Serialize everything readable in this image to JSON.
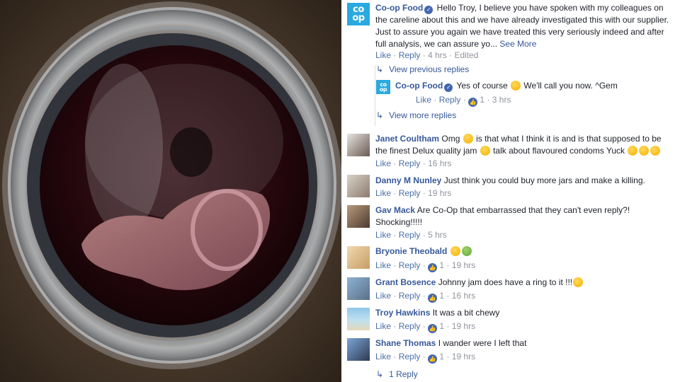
{
  "comments": {
    "coop_main": {
      "author": "Co-op Food",
      "text_line1": "Hello Troy, I believe you have spoken with my colleagues on",
      "text_line2": "the careline about this and we have already investigated this with our supplier.",
      "text_line3": "Just to assure you again we have treated this very seriously indeed and after",
      "text_line4": "full analysis, we can assure yo...",
      "see_more": "See More",
      "like": "Like",
      "reply": "Reply",
      "time": "4 hrs",
      "edited": "Edited"
    },
    "view_previous": "View previous replies",
    "coop_reply": {
      "author": "Co-op Food",
      "text_a": "Yes of course",
      "text_b": "We'll call you now. ^Gem",
      "like": "Like",
      "reply": "Reply",
      "likes": "1",
      "time": "3 hrs"
    },
    "view_more": "View more replies",
    "janet": {
      "author": "Janet Coultham",
      "text_a": "Omg",
      "text_b": "is that what I think it is and is that supposed to be",
      "text_c": "the finest Delux quality jam",
      "text_d": "talk about flavoured condoms Yuck",
      "like": "Like",
      "reply": "Reply",
      "time": "16 hrs"
    },
    "danny": {
      "author": "Danny M Nunley",
      "text": "Just think you could buy more jars and make a killing.",
      "like": "Like",
      "reply": "Reply",
      "time": "19 hrs"
    },
    "gav": {
      "author": "Gav Mack",
      "text_a": "Are Co-Op that embarrassed that they can't even reply?!",
      "text_b": "Shocking!!!!!",
      "like": "Like",
      "reply": "Reply",
      "time": "5 hrs"
    },
    "bryonie": {
      "author": "Bryonie Theobald",
      "like": "Like",
      "reply": "Reply",
      "likes": "1",
      "time": "19 hrs"
    },
    "grant": {
      "author": "Grant Bosence",
      "text": "Johnny jam does have a ring to it !!!",
      "like": "Like",
      "reply": "Reply",
      "likes": "1",
      "time": "16 hrs"
    },
    "troy": {
      "author": "Troy Hawkins",
      "text": "It was a bit chewy",
      "like": "Like",
      "reply": "Reply",
      "likes": "1",
      "time": "19 hrs"
    },
    "shane": {
      "author": "Shane Thomas",
      "text": "I wander were I left that",
      "like": "Like",
      "reply": "Reply",
      "likes": "1",
      "time": "19 hrs"
    },
    "one_reply": "1 Reply"
  },
  "logo_text": "co op",
  "colors": {
    "facebook_link": "#365899",
    "meta_gray": "#90949c",
    "coop_blue": "#2aa9e0",
    "like_blue": "#4267b2"
  },
  "icons": {
    "verified": "check-badge-icon",
    "like": "thumbs-up-icon",
    "reply_arrow": "reply-arrow-icon"
  }
}
